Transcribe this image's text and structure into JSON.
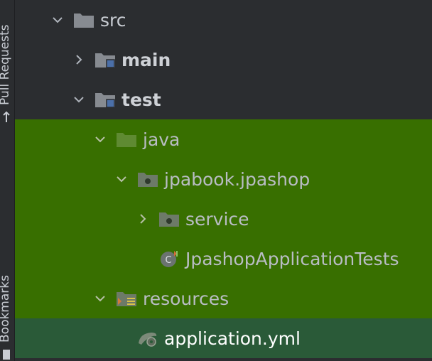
{
  "side": {
    "pull_requests_label": "Pull Requests",
    "bookmarks_label": "Bookmarks"
  },
  "tree": {
    "items": [
      {
        "label": "src",
        "expanded": true,
        "icon": "folder-icon"
      },
      {
        "label": "main",
        "expanded": false,
        "icon": "module-folder-icon"
      },
      {
        "label": "test",
        "expanded": true,
        "icon": "module-folder-icon"
      },
      {
        "label": "java",
        "expanded": true,
        "icon": "test-source-folder-icon"
      },
      {
        "label": "jpabook.jpashop",
        "expanded": true,
        "icon": "package-icon"
      },
      {
        "label": "service",
        "expanded": false,
        "icon": "package-icon"
      },
      {
        "label": "JpashopApplicationTests",
        "icon": "test-class-icon"
      },
      {
        "label": "resources",
        "expanded": true,
        "icon": "test-resources-folder-icon"
      },
      {
        "label": "application.yml",
        "icon": "spring-yaml-file-icon",
        "selected": true
      }
    ]
  },
  "colors": {
    "background": "#2b2d30",
    "test_highlight": "#386f00",
    "selection": "#2a5a38"
  }
}
